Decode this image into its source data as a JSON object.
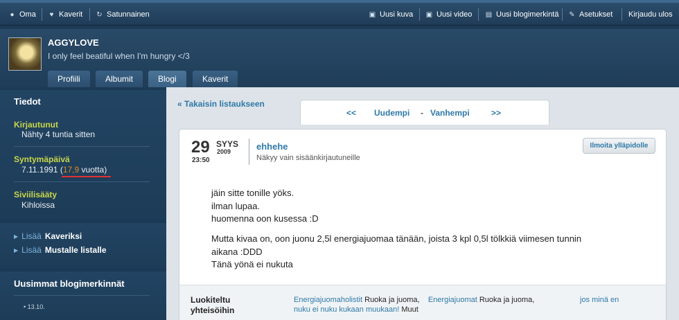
{
  "topnav": {
    "left": [
      {
        "label": "Oma",
        "icon": "user-icon"
      },
      {
        "label": "Kaverit",
        "icon": "heart-icon"
      },
      {
        "label": "Satunnainen",
        "icon": "refresh-icon"
      }
    ],
    "right": [
      {
        "label": "Uusi kuva",
        "icon": "image-icon"
      },
      {
        "label": "Uusi video",
        "icon": "video-icon"
      },
      {
        "label": "Uusi blogimerkintä",
        "icon": "document-icon"
      },
      {
        "label": "Asetukset",
        "icon": "wrench-icon"
      },
      {
        "label": "Kirjaudu ulos"
      }
    ]
  },
  "profile": {
    "username": "AGGYLOVE",
    "tagline": "I only feel beatiful when I'm hungry </3",
    "tabs": [
      "Profiili",
      "Albumit",
      "Blogi",
      "Kaverit"
    ],
    "active_tab": "Blogi"
  },
  "sidebar": {
    "info_title": "Tiedot",
    "logged_in_label": "Kirjautunut",
    "logged_in_value": "Nähty 4 tuntia sitten",
    "birthday_label": "Syntymäpäivä",
    "birthday_date": "7.11.1991 (",
    "birthday_age": "17,9",
    "birthday_suffix": " vuotta)",
    "marital_label": "Siviilisääty",
    "marital_value": "Kihloissa",
    "actions": [
      {
        "prefix": "Lisää",
        "strong": "Kaveriksi"
      },
      {
        "prefix": "Lisää",
        "strong": "Mustalle listalle"
      }
    ],
    "latest_title": "Uusimmat blogimerkinnät",
    "latest_item_date": "13.10."
  },
  "content": {
    "back_link": "« Takaisin listaukseen",
    "pager": {
      "prev_arrows": "<<",
      "newer": "Uudempi",
      "dash": "-",
      "older": "Vanhempi",
      "next_arrows": ">>"
    },
    "post": {
      "day": "29",
      "month": "SYYS",
      "year": "2009",
      "time": "23:50",
      "title": "ehhehe",
      "visibility": "Näkyy vain sisäänkirjautuneille",
      "report_button": "Ilmoita ylläpidolle",
      "lines": [
        "jäin sitte tonille yöks.",
        "ilman lupaa.",
        "huomenna oon kusessa :D",
        "Mutta kivaa on, oon juonu 2,5l energiajuomaa tänään, joista 3 kpl 0,5l tölkkiä viimesen tunnin",
        "aikana :DDD",
        "Tänä yönä ei nukuta"
      ],
      "categories_label": "Luokiteltu yhteisöihin",
      "categories": [
        {
          "link": "Energiajuomaholistit",
          "text": " Ruoka ja juoma,"
        },
        {
          "link": "Energiajuomat",
          "text": " Ruoka ja juoma,"
        },
        {
          "link": "jos minä en nuku ei nuku kukaan muukaan!",
          "text": " Muut"
        }
      ]
    }
  }
}
